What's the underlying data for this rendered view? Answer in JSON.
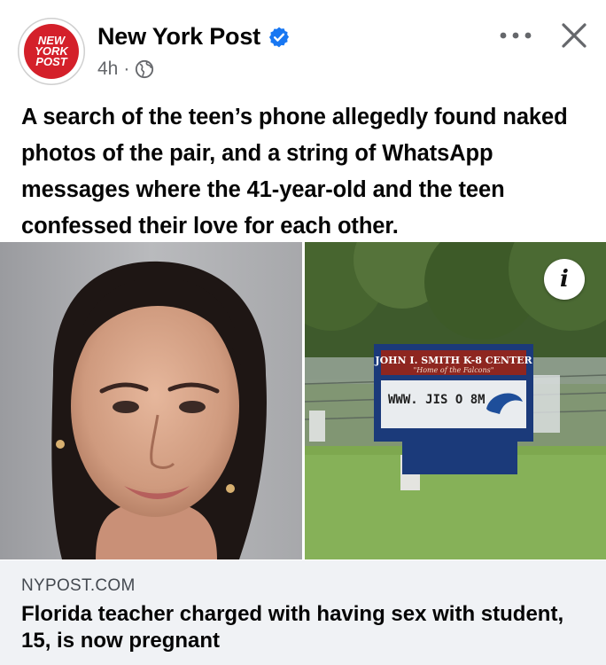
{
  "post": {
    "page_name": "New York Post",
    "avatar_text": "NEW YORK POST",
    "time_ago": "4h",
    "meta_separator": "·",
    "privacy_icon": "globe-icon",
    "verified_icon": "verified-badge-icon",
    "more_icon": "more-options-icon",
    "close_icon": "close-icon",
    "caption": "A search of the teen’s phone allegedly found naked photos of the pair, and a string of WhatsApp messages where the 41-year-old and the teen confessed their love for each other."
  },
  "media": {
    "sign_name": "JOHN I. SMITH K-8 CENTER",
    "sign_subtitle": "\"Home of the Falcons\"",
    "sign_board": "WWW. JIS O 8M",
    "info_label": "i"
  },
  "link_preview": {
    "domain": "NYPOST.COM",
    "headline": "Florida teacher charged with having sex with student, 15, is now pregnant"
  },
  "colors": {
    "brand_red": "#d4202a",
    "verified_blue": "#1877f2",
    "card_bg": "#f0f2f5",
    "secondary_text": "#65676b"
  }
}
